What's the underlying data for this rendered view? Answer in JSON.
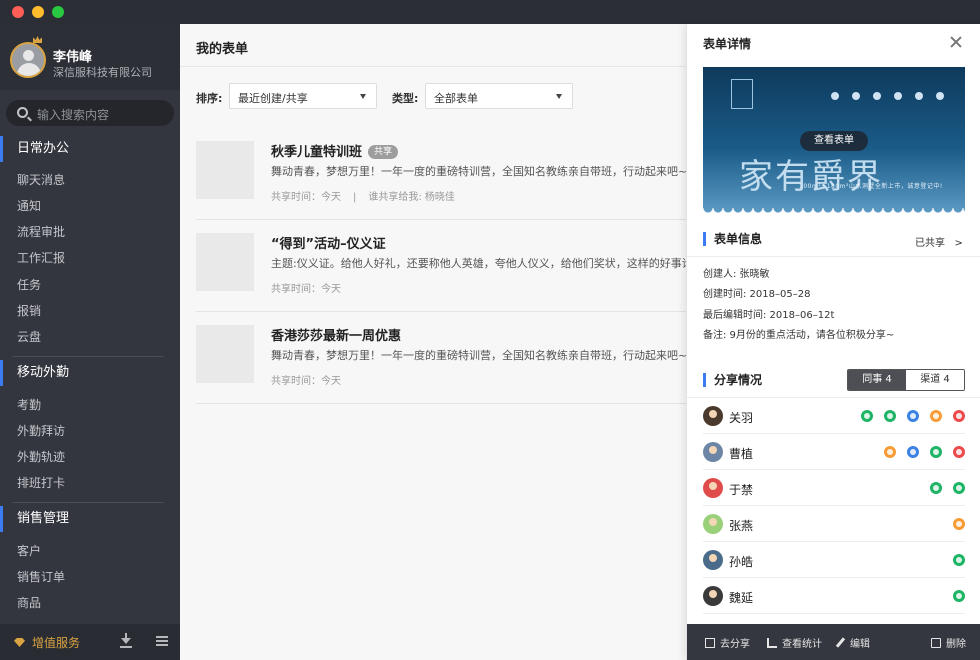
{
  "user": {
    "name": "李伟峰",
    "company": "深信服科技有限公司"
  },
  "search": {
    "placeholder": "输入搜索内容"
  },
  "sidebar": {
    "groups": [
      {
        "title": "日常办公",
        "items": [
          "聊天消息",
          "通知",
          "流程审批",
          "工作汇报",
          "任务",
          "报销",
          "云盘"
        ]
      },
      {
        "title": "移动外勤",
        "items": [
          "考勤",
          "外勤拜访",
          "外勤轨迹",
          "排班打卡"
        ]
      },
      {
        "title": "销售管理",
        "items": [
          "客户",
          "销售订单",
          "商品"
        ]
      }
    ],
    "bottom": {
      "vip_label": "增值服务"
    }
  },
  "main": {
    "title": "我的表单",
    "filters": {
      "sort_label": "排序:",
      "sort_value": "最近创建/共享",
      "type_label": "类型:",
      "type_value": "全部表单"
    },
    "forms": [
      {
        "title": "秋季儿童特训班",
        "badge": "共享",
        "desc": "舞动青春，梦想万里！一年一度的重磅特训营，全国知名教练亲自带班，行动起来吧~",
        "time": "共享时间：今天",
        "sharer": "谁共享给我: 杨晓佳"
      },
      {
        "title": "“得到”活动–仪义证",
        "badge": "",
        "desc": "主题:仪义证。给他人好礼，还要称他人英雄，夸他人仪义，给他们奖状，这样的好事谁会拒绝呢",
        "time": "共享时间：今天",
        "sharer": ""
      },
      {
        "title": "香港莎莎最新一周优惠",
        "badge": "",
        "desc": "舞动青春，梦想万里！一年一度的重磅特训营，全国知名教练亲自带班，行动起来吧~",
        "time": "共享时间：今天",
        "sharer": ""
      }
    ]
  },
  "panel": {
    "title": "表单详情",
    "cover": {
      "view_button": "查看表单",
      "big_text": "家有爵界",
      "sub_text": "100m²~180m²山水洞墅全新上市，诚意登记中!"
    },
    "info_title": "表单信息",
    "shared_status": "已共享",
    "info": {
      "creator": "创建人: 张晓敏",
      "created": "创建时间: 2018–05–28",
      "edited": "最后编辑时间: 2018–06–12t",
      "note": "备注: 9月份的重点活动，请各位积极分享~"
    },
    "share_title": "分享情况",
    "tabs": {
      "colleagues": "同事 4",
      "channels": "渠道 4"
    },
    "people": [
      {
        "name": "关羽",
        "avatar_color": "#4a3a2e",
        "channels": [
          "green",
          "green",
          "blue",
          "orange",
          "red"
        ]
      },
      {
        "name": "曹植",
        "avatar_color": "#6e86a6",
        "channels": [
          "orange",
          "blue",
          "green",
          "red"
        ]
      },
      {
        "name": "于禁",
        "avatar_color": "#e04b4b",
        "channels": [
          "green",
          "green"
        ]
      },
      {
        "name": "张燕",
        "avatar_color": "#9ad07a",
        "channels": [
          "orange"
        ]
      },
      {
        "name": "孙皓",
        "avatar_color": "#4b6b8a",
        "channels": [
          "green"
        ]
      },
      {
        "name": "魏延",
        "avatar_color": "#3a3a3a",
        "channels": [
          "green"
        ]
      }
    ],
    "footer": {
      "share": "去分享",
      "stats": "查看统计",
      "edit": "编辑",
      "delete": "删除"
    }
  }
}
